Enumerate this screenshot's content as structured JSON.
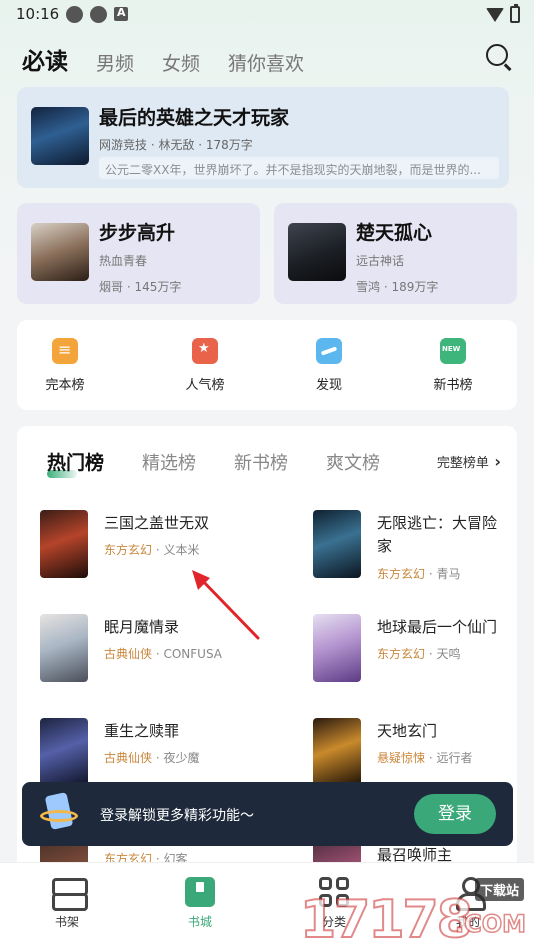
{
  "status_bar": {
    "time": "10:16"
  },
  "top_tabs": [
    {
      "label": "必读",
      "active": true
    },
    {
      "label": "男频",
      "active": false
    },
    {
      "label": "女频",
      "active": false
    },
    {
      "label": "猜你喜欢",
      "active": false
    }
  ],
  "featured": {
    "title": "最后的英雄之天才玩家",
    "meta": "网游竞技 · 林无敌 · 178万字",
    "desc": "公元二零XX年，世界崩坏了。并不是指现实的天崩地裂，而是世界的..."
  },
  "cards": [
    {
      "title": "步步高升",
      "genre": "热血青春",
      "author": "烟哥 · 145万字"
    },
    {
      "title": "楚天孤心",
      "genre": "远古神话",
      "author": "雪鸿 · 189万字"
    }
  ],
  "shortcuts": [
    {
      "label": "完本榜",
      "icon": "finished-list-icon"
    },
    {
      "label": "人气榜",
      "icon": "trophy-icon"
    },
    {
      "label": "发现",
      "icon": "discover-icon"
    },
    {
      "label": "新书榜",
      "icon": "new-book-icon"
    }
  ],
  "rank_tabs": [
    {
      "label": "热门榜",
      "active": true
    },
    {
      "label": "精选榜",
      "active": false
    },
    {
      "label": "新书榜",
      "active": false
    },
    {
      "label": "爽文榜",
      "active": false
    }
  ],
  "full_list_label": "完整榜单",
  "rank_items": [
    {
      "title": "三国之盖世无双",
      "genre": "东方玄幻",
      "author": "义本米"
    },
    {
      "title": "无限逃亡：大冒险家",
      "genre": "东方玄幻",
      "author": "青马"
    },
    {
      "title": "眠月魔情录",
      "genre": "古典仙侠",
      "author": "CONFUSA"
    },
    {
      "title": "地球最后一个仙门",
      "genre": "东方玄幻",
      "author": "天鸣"
    },
    {
      "title": "重生之赎罪",
      "genre": "古典仙侠",
      "author": "夜少魔"
    },
    {
      "title": "天地玄门",
      "genre": "悬疑惊悚",
      "author": "远行者"
    },
    {
      "title": "",
      "genre": "东方玄幻",
      "author": "幻客"
    },
    {
      "title": "最召唤师主",
      "genre": "",
      "author": ""
    }
  ],
  "login_banner": {
    "text": "登录解锁更多精彩功能～",
    "button": "登录"
  },
  "bottom_nav": [
    {
      "label": "书架",
      "active": false
    },
    {
      "label": "书城",
      "active": true
    },
    {
      "label": "分类",
      "active": false
    },
    {
      "label": "我的",
      "active": false
    }
  ],
  "watermark": {
    "number": "17178",
    "site": "下载站",
    "domain": ".COM"
  },
  "colors": {
    "accent": "#3aa879",
    "genre": "#c9873c",
    "banner_bg": "#1e2a3b"
  }
}
